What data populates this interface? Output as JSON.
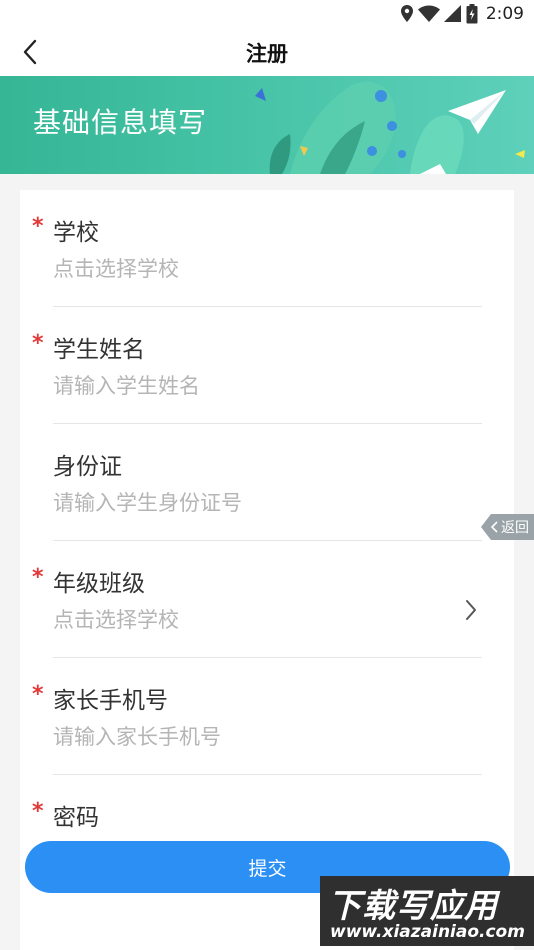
{
  "status_bar": {
    "time": "2:09",
    "icons": [
      "location-icon",
      "wifi-icon",
      "signal-icon",
      "battery-icon"
    ]
  },
  "nav": {
    "title": "注册"
  },
  "banner": {
    "title": "基础信息填写"
  },
  "fields": [
    {
      "label": "学校",
      "value": "点击选择学校",
      "required": true
    },
    {
      "label": "学生姓名",
      "value": "请输入学生姓名",
      "required": true
    },
    {
      "label": "身份证",
      "value": "请输入学生身份证号",
      "required": false
    },
    {
      "label": "年级班级",
      "value": "点击选择学校",
      "required": true
    },
    {
      "label": "家长手机号",
      "value": "请输入家长手机号",
      "required": true
    },
    {
      "label": "密码",
      "value": "",
      "required": true
    }
  ],
  "side_back": {
    "label": "返回"
  },
  "submit": {
    "label": "提交"
  },
  "watermark": {
    "title": "下载写应用",
    "url": "www.xiazainiao.com"
  },
  "colors": {
    "accent": "#2b8ff3",
    "banner": "#46c3a6",
    "required": "#e23838"
  }
}
